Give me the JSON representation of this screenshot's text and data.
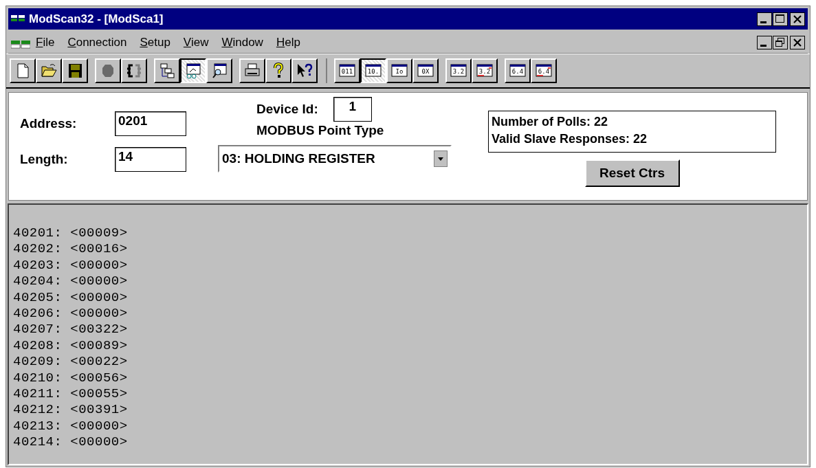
{
  "window": {
    "title": "ModScan32 - [ModSca1]"
  },
  "menu": [
    {
      "label": "File"
    },
    {
      "label": "Connection"
    },
    {
      "label": "Setup"
    },
    {
      "label": "View"
    },
    {
      "label": "Window"
    },
    {
      "label": "Help"
    }
  ],
  "toolbar": [
    [
      {
        "kind": "new",
        "pressed": false,
        "disabled": false
      },
      {
        "kind": "open",
        "pressed": false,
        "disabled": false
      },
      {
        "kind": "save",
        "pressed": false,
        "disabled": false
      }
    ],
    [
      {
        "kind": "connect",
        "pressed": false,
        "disabled": true
      },
      {
        "kind": "disconnect",
        "pressed": false,
        "disabled": false
      }
    ],
    [
      {
        "kind": "tree",
        "pressed": false,
        "disabled": false
      },
      {
        "kind": "display",
        "pressed": true,
        "disabled": false
      },
      {
        "kind": "inspect",
        "pressed": false,
        "disabled": false
      }
    ],
    [
      {
        "kind": "print",
        "pressed": false,
        "disabled": false
      },
      {
        "kind": "help",
        "pressed": false,
        "disabled": false
      },
      {
        "kind": "context-help",
        "pressed": false,
        "disabled": false
      }
    ],
    [
      {
        "kind": "format",
        "label": "011",
        "crossed": false,
        "pressed": false,
        "disabled": false
      },
      {
        "kind": "format",
        "label": "10.",
        "crossed": false,
        "pressed": true,
        "disabled": false
      },
      {
        "kind": "format",
        "label": "Io",
        "crossed": false,
        "pressed": false,
        "disabled": false
      },
      {
        "kind": "format",
        "label": "0X",
        "crossed": false,
        "pressed": false,
        "disabled": false
      }
    ],
    [
      {
        "kind": "format",
        "label": "3.2",
        "crossed": false,
        "pressed": false,
        "disabled": false
      },
      {
        "kind": "format",
        "label": "3.2",
        "crossed": true,
        "pressed": false,
        "disabled": false
      }
    ],
    [
      {
        "kind": "format",
        "label": "6.4",
        "crossed": false,
        "pressed": false,
        "disabled": false
      },
      {
        "kind": "format",
        "label": "6.4",
        "crossed": true,
        "pressed": false,
        "disabled": false
      }
    ]
  ],
  "form": {
    "address_label": "Address:",
    "address": "0201",
    "length_label": "Length:",
    "length": "14",
    "device_id_label": "Device Id:",
    "device_id": "1",
    "point_type_label": "MODBUS Point Type",
    "point_type": "03: HOLDING REGISTER",
    "stats": [
      "Number of Polls: 22",
      "Valid Slave Responses: 22"
    ],
    "reset_button": "Reset Ctrs"
  },
  "registers": [
    "40201: <00009>",
    "40202: <00016>",
    "40203: <00000>",
    "40204: <00000>",
    "40205: <00000>",
    "40206: <00000>",
    "40207: <00322>",
    "40208: <00089>",
    "40209: <00022>",
    "40210: <00056>",
    "40211: <00055>",
    "40212: <00391>",
    "40213: <00000>",
    "40214: <00000>"
  ]
}
